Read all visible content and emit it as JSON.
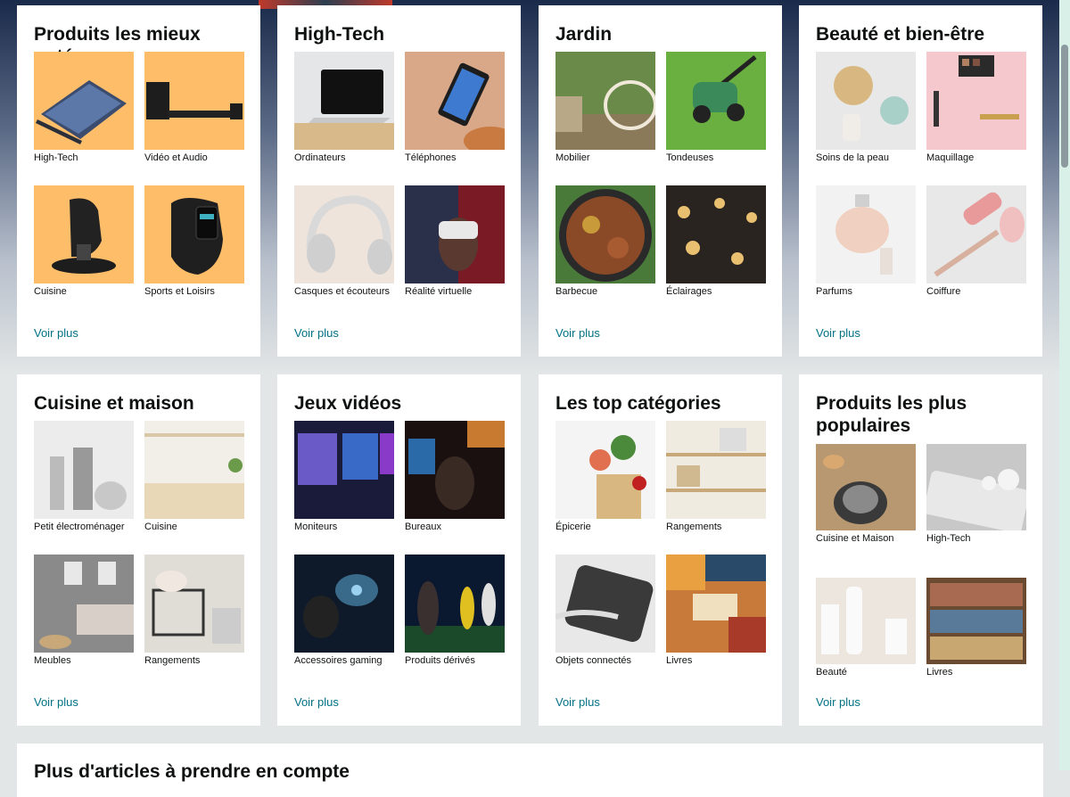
{
  "cards": [
    {
      "title": "Produits les mieux notés",
      "see_more": "Voir plus",
      "tiles": [
        {
          "label": "High-Tech",
          "image": "tablet-keyboard-image"
        },
        {
          "label": "Vidéo et Audio",
          "image": "soundbar-image"
        },
        {
          "label": "Cuisine",
          "image": "coffee-machine-image"
        },
        {
          "label": "Sports et Loisirs",
          "image": "fitness-tracker-image"
        }
      ]
    },
    {
      "title": "High-Tech",
      "see_more": "Voir plus",
      "tiles": [
        {
          "label": "Ordinateurs",
          "image": "laptop-image"
        },
        {
          "label": "Téléphones",
          "image": "smartphone-image"
        },
        {
          "label": "Casques et écouteurs",
          "image": "headphones-image"
        },
        {
          "label": "Réalité virtuelle",
          "image": "vr-headset-image"
        }
      ]
    },
    {
      "title": "Jardin",
      "see_more": "Voir plus",
      "tiles": [
        {
          "label": "Mobilier",
          "image": "garden-swing-image"
        },
        {
          "label": "Tondeuses",
          "image": "lawn-mower-image"
        },
        {
          "label": "Barbecue",
          "image": "grill-image"
        },
        {
          "label": "Éclairages",
          "image": "string-lights-image"
        }
      ]
    },
    {
      "title": "Beauté et bien-être",
      "see_more": "Voir plus",
      "tiles": [
        {
          "label": "Soins de la peau",
          "image": "skincare-image"
        },
        {
          "label": "Maquillage",
          "image": "makeup-image"
        },
        {
          "label": "Parfums",
          "image": "perfume-image"
        },
        {
          "label": "Coiffure",
          "image": "hair-tools-image"
        }
      ]
    },
    {
      "title": "Cuisine et maison",
      "see_more": "Voir plus",
      "tiles": [
        {
          "label": "Petit électroménager",
          "image": "kitchen-appliances-image"
        },
        {
          "label": "Cuisine",
          "image": "kitchen-room-image"
        },
        {
          "label": "Meubles",
          "image": "living-room-image"
        },
        {
          "label": "Rangements",
          "image": "storage-baskets-image"
        }
      ]
    },
    {
      "title": "Jeux vidéos",
      "see_more": "Voir plus",
      "tiles": [
        {
          "label": "Moniteurs",
          "image": "gaming-monitors-image"
        },
        {
          "label": "Bureaux",
          "image": "gaming-desk-image"
        },
        {
          "label": "Accessoires gaming",
          "image": "gaming-headset-image"
        },
        {
          "label": "Produits dérivés",
          "image": "football-game-image"
        }
      ]
    },
    {
      "title": "Les top catégories",
      "see_more": "Voir plus",
      "tiles": [
        {
          "label": "Épicerie",
          "image": "groceries-image"
        },
        {
          "label": "Rangements",
          "image": "shelves-image"
        },
        {
          "label": "Objets connectés",
          "image": "power-bank-image"
        },
        {
          "label": "Livres",
          "image": "books-stack-image"
        }
      ]
    },
    {
      "title": "Produits les plus populaires",
      "see_more": "Voir plus",
      "tiles": [
        {
          "label": "Cuisine et Maison",
          "image": "cookware-image"
        },
        {
          "label": "High-Tech",
          "image": "earbuds-phone-image"
        },
        {
          "label": "Beauté",
          "image": "cosmetics-bottles-image"
        },
        {
          "label": "Livres",
          "image": "bookshelf-image"
        }
      ]
    }
  ],
  "bottom_card": {
    "title": "Plus d'articles à prendre en compte"
  },
  "colors": {
    "link": "#007185",
    "accent_orange": "#febd69",
    "background": "#e3e6e6"
  }
}
